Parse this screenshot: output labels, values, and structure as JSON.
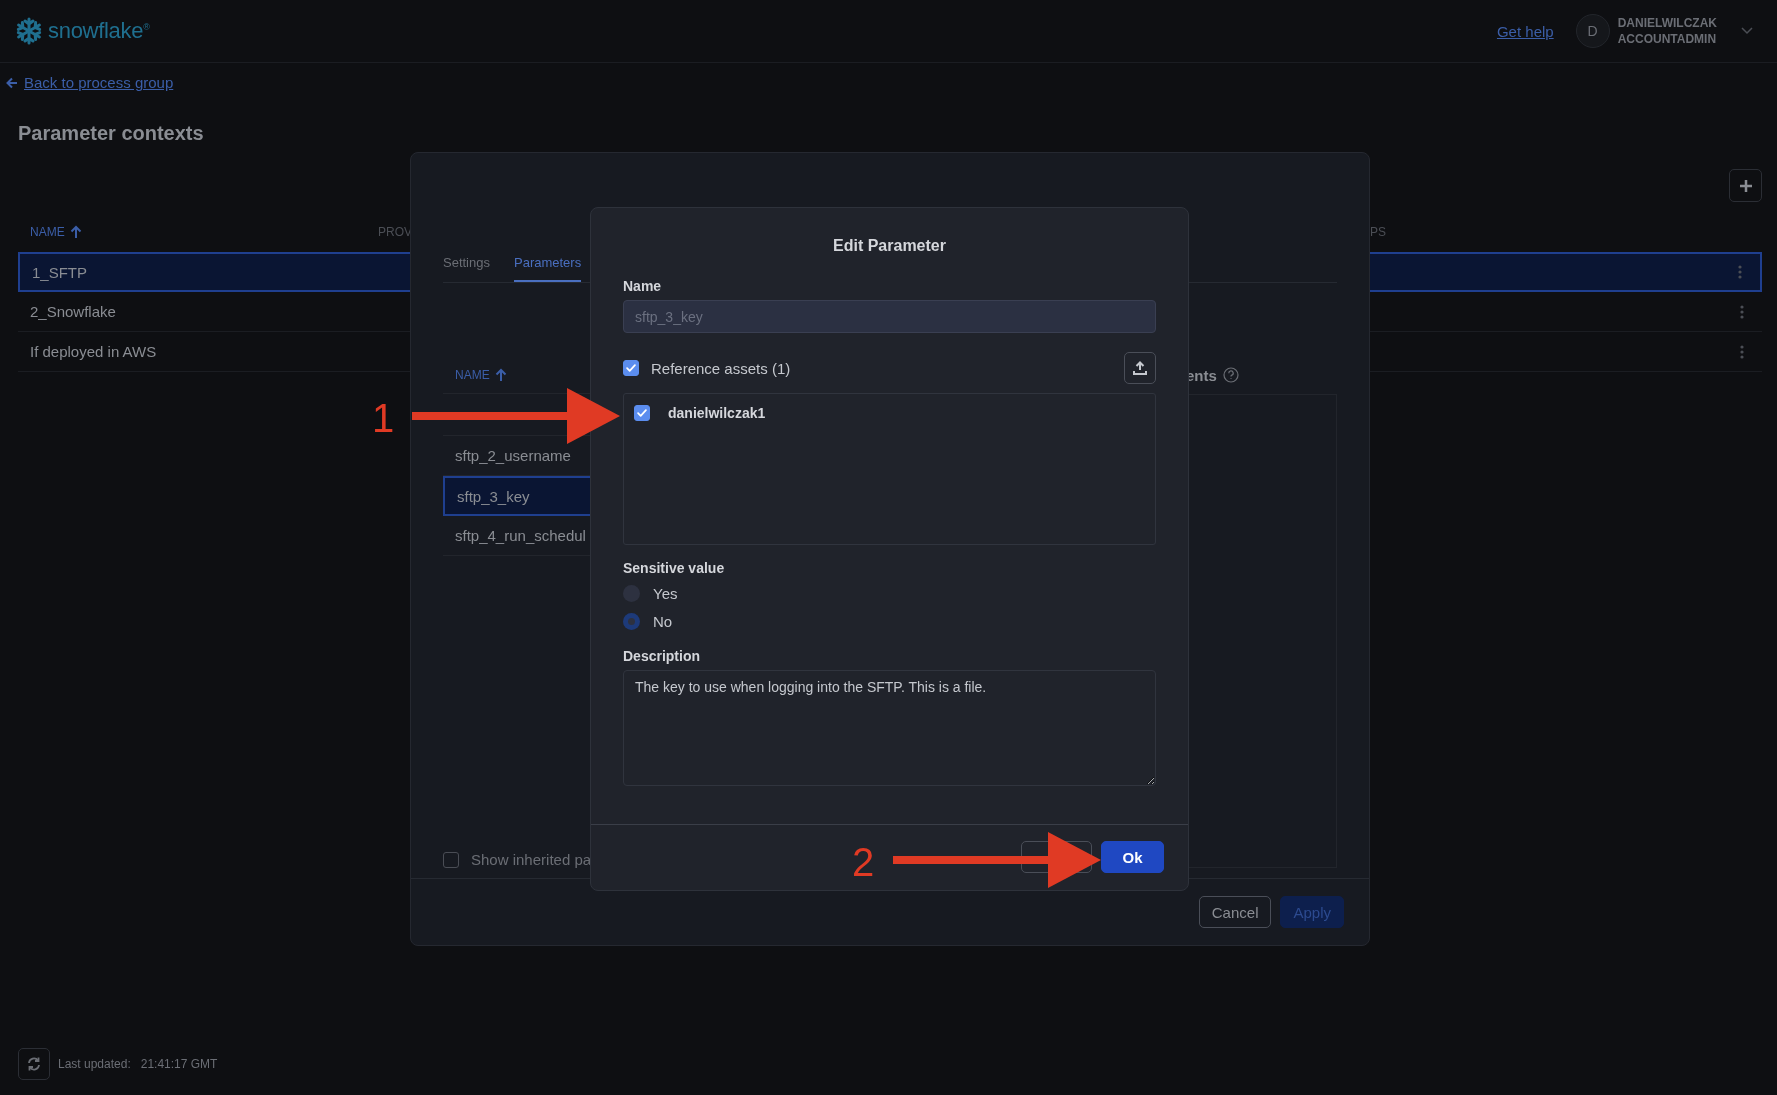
{
  "header": {
    "logo": "snowflake$^{®}$",
    "help_link": "Get help",
    "avatar": "D",
    "user_name": "DANIELWILCZAK",
    "user_role": "ACCOUNTADMIN"
  },
  "back_link": "Back to process group",
  "page_title": "Parameter contexts",
  "table": {
    "columns": [
      {
        "label": "NAME",
        "sorted": true
      },
      {
        "label": "PROV",
        "sorted": false
      },
      {
        "label": "PS",
        "sorted": false
      }
    ],
    "rows": [
      {
        "name": "1_SFTP",
        "selected": true
      },
      {
        "name": "2_Snowflake",
        "selected": false
      },
      {
        "name": "If deployed in AWS",
        "selected": false
      }
    ]
  },
  "context_dialog": {
    "tabs": [
      {
        "label": "Settings",
        "selected": false
      },
      {
        "label": "Parameters",
        "selected": true
      }
    ],
    "table": {
      "column": "NAME",
      "rows": [
        {
          "name": "sftp_2_username",
          "selected": false
        },
        {
          "name": "sftp_3_key",
          "selected": true
        },
        {
          "name": "sftp_4_run_schedul",
          "selected": false
        }
      ]
    },
    "side_label": "ents",
    "inherited": {
      "label": "Show inherited pa",
      "checked": false
    },
    "buttons": [
      {
        "label": "Cancel",
        "kind": "secondary",
        "disabled": false
      },
      {
        "label": "Apply",
        "kind": "primary",
        "disabled": true
      }
    ]
  },
  "edit_dialog": {
    "title": "Edit Parameter",
    "name_label": "Name",
    "name_value": "sftp_3_key",
    "reference_assets": {
      "label": "Reference assets (1)",
      "checked": true
    },
    "assets": [
      {
        "name": "danielwilczak1",
        "checked": true
      }
    ],
    "sensitive": {
      "label": "Sensitive value",
      "options": [
        {
          "label": "Yes",
          "selected": false
        },
        {
          "label": "No",
          "selected": true
        }
      ]
    },
    "description_label": "Description",
    "description": "The key to use when logging into the SFTP. This is a file.",
    "buttons": [
      {
        "kind": "secondary"
      },
      {
        "label": "Ok",
        "kind": "primary"
      }
    ]
  },
  "annotations": [
    {
      "label": "1"
    },
    {
      "label": "2"
    }
  ],
  "footer": {
    "label": "Last updated:",
    "time": "21:41:17 GMT"
  }
}
